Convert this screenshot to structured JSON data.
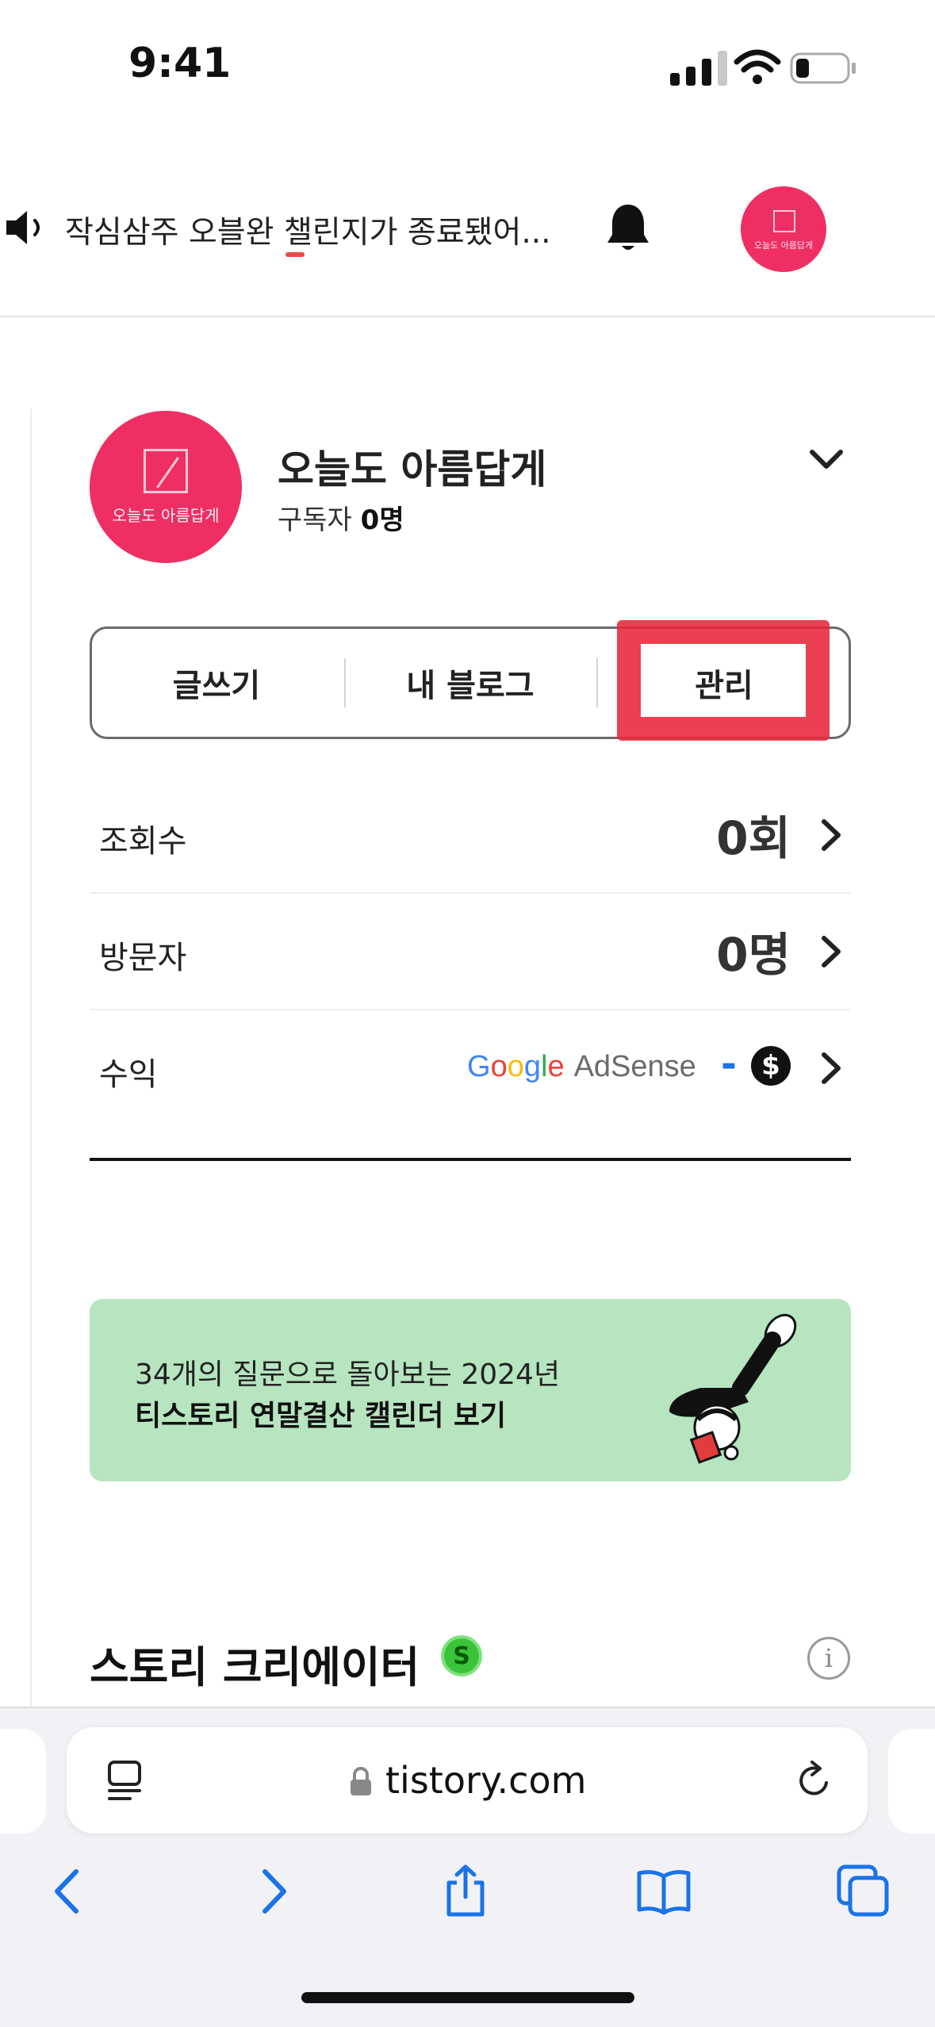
{
  "status_bar": {
    "time": "9:41"
  },
  "notice": {
    "text": "작심삼주 오블완 챌린지가 종료됐어..."
  },
  "top_avatar": {
    "label": "오늘도 아름답게"
  },
  "blog": {
    "name": "오늘도 아름답게",
    "avatar_label": "오늘도 아름답게",
    "subscriber_label": "구독자",
    "subscriber_count": "0명"
  },
  "actions": {
    "write": "글쓰기",
    "my_blog": "내 블로그",
    "manage": "관리"
  },
  "stats": {
    "views": {
      "label": "조회수",
      "value": "0회"
    },
    "visitors": {
      "label": "방문자",
      "value": "0명"
    },
    "revenue": {
      "label": "수익",
      "provider_word1": "Google",
      "provider_word2": "AdSense",
      "value": "-",
      "currency_symbol": "$"
    }
  },
  "banner": {
    "line1": "34개의 질문으로 돌아보는 2024년",
    "line2": "티스토리 연말결산 캘린더 보기",
    "background_color": "#b6e5c0"
  },
  "story_creator": {
    "title": "스토리 크리에이터",
    "badge": "S",
    "info_glyph": "i"
  },
  "browser": {
    "url": "tistory.com"
  },
  "colors": {
    "accent_pink": "#ef2f63",
    "highlight_red": "#e8263a",
    "ios_blue": "#1a73e8"
  }
}
